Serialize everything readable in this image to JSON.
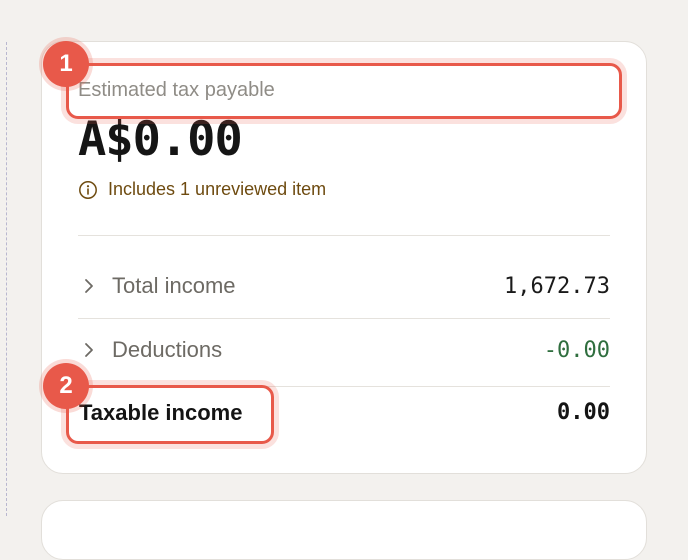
{
  "summary": {
    "estimated_label": "Estimated tax payable",
    "amount": "A$0.00",
    "notice": "Includes 1 unreviewed item",
    "notice_icon": "info-icon",
    "rows": [
      {
        "label": "Total income",
        "value": "1,672.73",
        "icon": "chevron-right-icon"
      },
      {
        "label": "Deductions",
        "value": "-0.00",
        "icon": "chevron-right-icon",
        "value_color": "#2f6e3e"
      }
    ],
    "taxable_label": "Taxable income",
    "taxable_value": "0.00"
  },
  "annotations": {
    "markers": [
      "1",
      "2"
    ],
    "highlight_color": "#e8594a"
  },
  "colors": {
    "background": "#f3f1ee",
    "card": "#ffffff",
    "notice_text": "#6e4b10"
  }
}
